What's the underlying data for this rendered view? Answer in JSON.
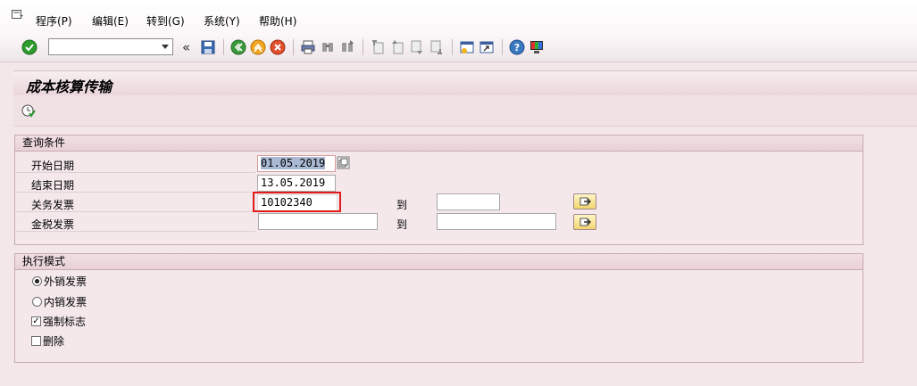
{
  "menu": {
    "items": [
      {
        "label": "程序(P)"
      },
      {
        "label": "编辑(E)"
      },
      {
        "label": "转到(G)"
      },
      {
        "label": "系统(Y)"
      },
      {
        "label": "帮助(H)"
      }
    ]
  },
  "toolbar": {
    "command_field_value": "",
    "icons": [
      "check-icon",
      "save-icon",
      "back-icon",
      "exit-icon",
      "cancel-icon",
      "print-icon",
      "find-icon",
      "find-next-icon",
      "first-page-icon",
      "previous-page-icon",
      "next-page-icon",
      "last-page-icon",
      "create-session-icon",
      "shortcut-icon",
      "help-icon",
      "customize-layout-icon"
    ]
  },
  "page": {
    "title": "成本核算传输",
    "execute_icon": "execute-icon"
  },
  "query_group": {
    "title": "查询条件",
    "start_date": {
      "label": "开始日期",
      "value": "01.05.2019"
    },
    "end_date": {
      "label": "结束日期",
      "value": "13.05.2019"
    },
    "customs_invoice": {
      "label": "关务发票",
      "from": "10102340",
      "to_label": "到",
      "to": ""
    },
    "tax_invoice": {
      "label": "金税发票",
      "from": "",
      "to_label": "到",
      "to": ""
    }
  },
  "mode_group": {
    "title": "执行模式",
    "options": [
      {
        "label": "外销发票",
        "type": "radio",
        "checked": true
      },
      {
        "label": "内销发票",
        "type": "radio",
        "checked": false
      },
      {
        "label": "强制标志",
        "type": "checkbox",
        "checked": true
      },
      {
        "label": "删除",
        "type": "checkbox",
        "checked": false
      }
    ]
  },
  "colors": {
    "background": "#f3e7ea",
    "highlight_box": "#e01b1b",
    "selection": "#aab9d3"
  }
}
